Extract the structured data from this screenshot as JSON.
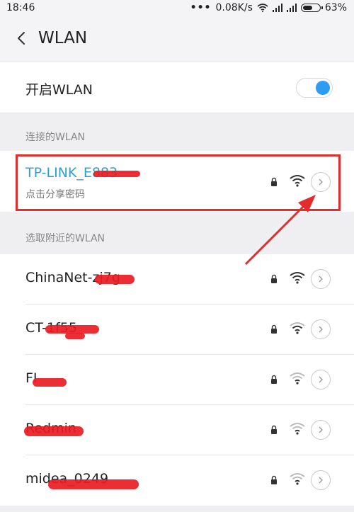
{
  "status_bar": {
    "time": "18:46",
    "dots": "•••",
    "network_speed": "0.08K/s",
    "battery_percent": "63%",
    "battery_level": 0.63
  },
  "header": {
    "back_icon": "chevron-left-icon",
    "title": "WLAN"
  },
  "wlan_toggle": {
    "label": "开启WLAN",
    "enabled": true,
    "accent_color": "#2e9df1"
  },
  "connected_section": {
    "header": "连接的WLAN",
    "network": {
      "ssid": "TP-LINK_E883",
      "subtitle": "点击分享密码",
      "color": "#2ba0d1"
    }
  },
  "nearby_section": {
    "header": "选取附近的WLAN",
    "networks": [
      {
        "ssid": "ChinaNet-zj7g"
      },
      {
        "ssid": "CT-1f55"
      },
      {
        "ssid": "FI"
      },
      {
        "ssid": "Redmin"
      },
      {
        "ssid": "midea_0249"
      }
    ]
  },
  "annotation": {
    "highlight_color": "#e32c2c"
  }
}
